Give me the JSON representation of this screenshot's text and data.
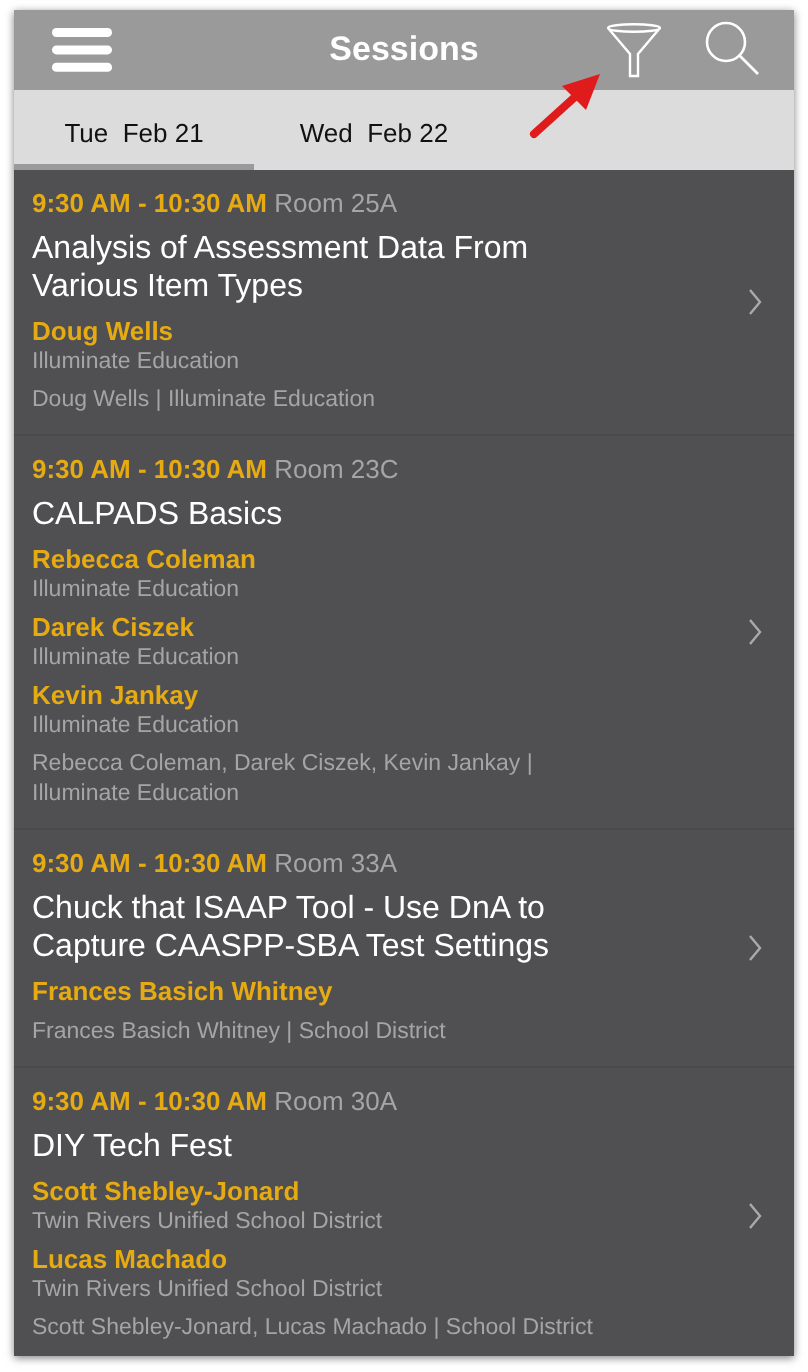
{
  "header": {
    "title": "Sessions"
  },
  "tabs": [
    {
      "label": "Tue  Feb 21",
      "selected": true
    },
    {
      "label": "Wed  Feb 22",
      "selected": false
    }
  ],
  "sessions": [
    {
      "time": "9:30 AM - 10:30 AM",
      "room": "Room 25A",
      "title": "Analysis of Assessment Data From Various Item Types",
      "speakers": [
        {
          "name": "Doug Wells",
          "org": "Illuminate Education"
        }
      ],
      "summary": "Doug Wells | Illuminate Education"
    },
    {
      "time": "9:30 AM - 10:30 AM",
      "room": "Room 23C",
      "title": "CALPADS Basics",
      "speakers": [
        {
          "name": "Rebecca Coleman",
          "org": "Illuminate Education"
        },
        {
          "name": "Darek Ciszek",
          "org": "Illuminate Education"
        },
        {
          "name": "Kevin Jankay",
          "org": "Illuminate Education"
        }
      ],
      "summary": "Rebecca Coleman, Darek Ciszek, Kevin Jankay | Illuminate Education"
    },
    {
      "time": "9:30 AM - 10:30 AM",
      "room": "Room 33A",
      "title": "Chuck that ISAAP Tool - Use DnA to Capture CAASPP-SBA Test Settings",
      "speakers": [
        {
          "name": "Frances Basich Whitney"
        }
      ],
      "summary": "Frances Basich Whitney | School District"
    },
    {
      "time": "9:30 AM - 10:30 AM",
      "room": "Room 30A",
      "title": "DIY Tech Fest",
      "speakers": [
        {
          "name": "Scott Shebley-Jonard",
          "org": "Twin Rivers Unified School District"
        },
        {
          "name": "Lucas Machado",
          "org": "Twin Rivers Unified School District"
        }
      ],
      "summary": "Scott Shebley-Jonard, Lucas Machado | School District"
    }
  ]
}
